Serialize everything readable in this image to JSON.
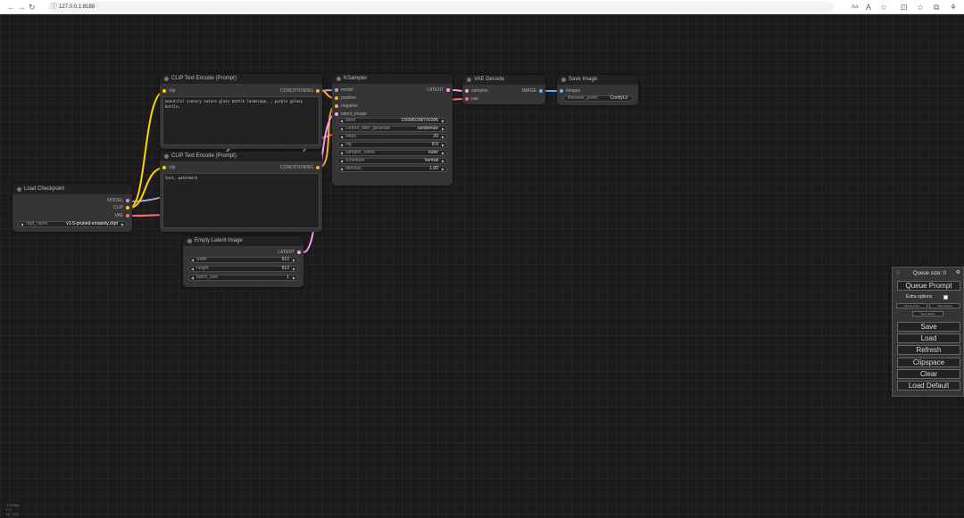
{
  "browser": {
    "url": "127.0.0.1:8188",
    "right_icons": [
      "Aa",
      "A",
      "☆",
      "⊡",
      "☆",
      "⧉",
      "⚘"
    ]
  },
  "nodes": {
    "clip_pos": {
      "title": "CLIP Text Encode (Prompt)",
      "input_clip": "clip",
      "output": "CONDITIONING",
      "text": "beautiful scenery nature glass bottle landscape, , purple galaxy bottle,"
    },
    "clip_neg": {
      "title": "CLIP Text Encode (Prompt)",
      "input_clip": "clip",
      "output": "CONDITIONING",
      "text": "text, watermark"
    },
    "ksampler": {
      "title": "KSampler",
      "inputs": [
        "model",
        "positive",
        "negative",
        "latent_image"
      ],
      "output": "LATENT",
      "widgets": [
        {
          "name": "seed",
          "value": "156680208700286"
        },
        {
          "name": "control_after_generate",
          "value": "randomize"
        },
        {
          "name": "steps",
          "value": "20"
        },
        {
          "name": "cfg",
          "value": "8.0"
        },
        {
          "name": "sampler_name",
          "value": "euler"
        },
        {
          "name": "scheduler",
          "value": "normal"
        },
        {
          "name": "denoise",
          "value": "1.00"
        }
      ]
    },
    "vae_decode": {
      "title": "VAE Decode",
      "inputs": [
        "samples",
        "vae"
      ],
      "output": "IMAGE"
    },
    "save_image": {
      "title": "Save Image",
      "input": "images",
      "prefix_name": "filename_prefix",
      "prefix_value": "ComfyUI"
    },
    "load_checkpoint": {
      "title": "Load Checkpoint",
      "outputs": [
        "MODEL",
        "CLIP",
        "VAE"
      ],
      "ckpt_name": "ckpt_name",
      "ckpt_value": "v1-5-pruned-emaonly.ckpt"
    },
    "empty_latent": {
      "title": "Empty Latent Image",
      "output": "LATENT",
      "widgets": [
        {
          "name": "width",
          "value": "512"
        },
        {
          "name": "height",
          "value": "512"
        },
        {
          "name": "batch_size",
          "value": "1"
        }
      ]
    }
  },
  "menu": {
    "queue_size": "Queue size: 0",
    "queue_prompt": "Queue Prompt",
    "extra_options": "Extra options",
    "queue_front": "Queue Front",
    "view_queue": "View Queue",
    "view_history": "View History",
    "save": "Save",
    "load": "Load",
    "refresh": "Refresh",
    "clipspace": "Clipspace",
    "clear": "Clear",
    "load_default": "Load Default"
  },
  "stats": "T: 0.00s\nI: 0\nN: 7 [7]\nV: 14\nFPS:156.72",
  "colors": {
    "model": "#b39ddb",
    "clip": "#ffd500",
    "vae": "#ff6e6e",
    "conditioning": "#ffa931",
    "latent": "#ff9cf9",
    "image": "#64b5f6"
  }
}
